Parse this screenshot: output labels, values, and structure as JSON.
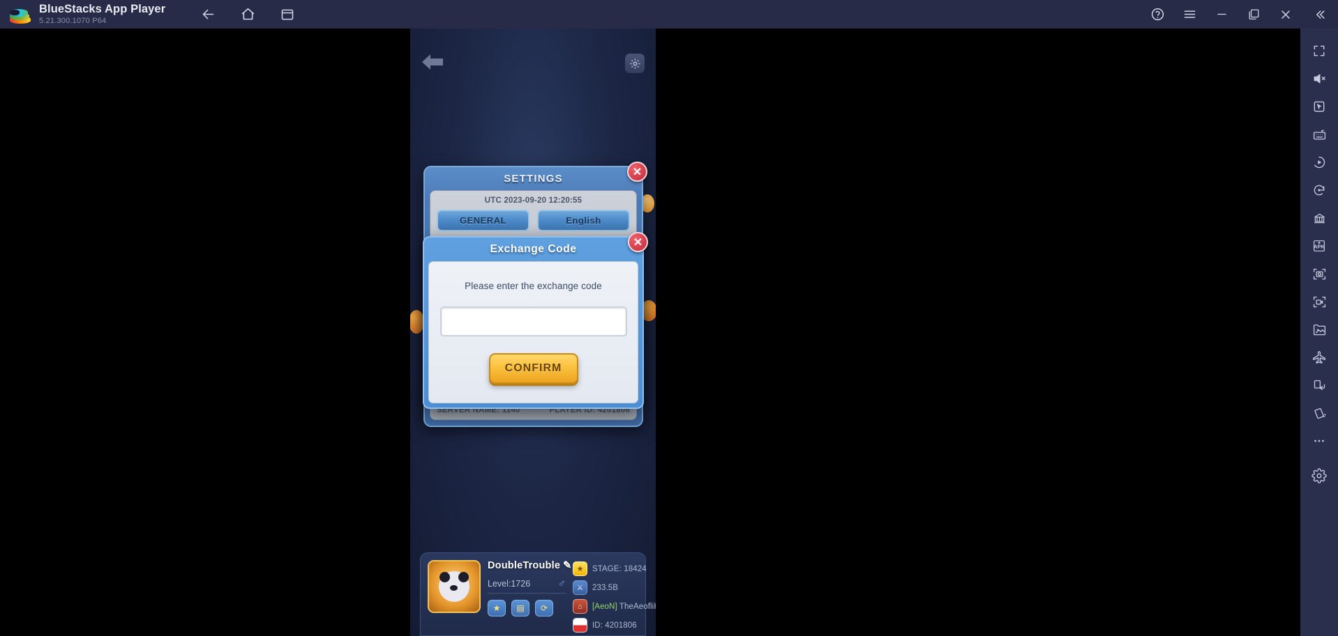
{
  "titlebar": {
    "app_title": "BlueStacks App Player",
    "version": "5.21.300.1070  P64",
    "nav": [
      {
        "name": "back",
        "glyph": "←"
      },
      {
        "name": "home",
        "glyph": "⌂"
      },
      {
        "name": "recents",
        "glyph": "▭"
      }
    ],
    "right": [
      {
        "name": "help",
        "glyph": "?"
      },
      {
        "name": "menu",
        "glyph": "☰"
      },
      {
        "name": "minimize",
        "glyph": "—"
      },
      {
        "name": "maximize",
        "glyph": "❐"
      },
      {
        "name": "close",
        "glyph": "✕"
      },
      {
        "name": "collapse",
        "glyph": "«"
      }
    ]
  },
  "sidebar": {
    "items": [
      {
        "name": "fullscreen-icon",
        "label": "Fullscreen"
      },
      {
        "name": "mute-icon",
        "label": "Mute"
      },
      {
        "name": "cursor-icon",
        "label": "Cursor"
      },
      {
        "name": "keyboard-controls-icon",
        "label": "Game controls"
      },
      {
        "name": "macro-icon",
        "label": "Macro recorder"
      },
      {
        "name": "rotate-icon",
        "label": "Rotate"
      },
      {
        "name": "multi-instance-icon",
        "label": "Multi-instance manager"
      },
      {
        "name": "install-apk-icon",
        "label": "Install APK"
      },
      {
        "name": "screenshot-icon",
        "label": "Screenshot"
      },
      {
        "name": "record-screen-icon",
        "label": "Record screen"
      },
      {
        "name": "media-manager-icon",
        "label": "Media manager"
      },
      {
        "name": "eco-mode-icon",
        "label": "Eco mode"
      },
      {
        "name": "rotate-screen-icon",
        "label": "Rotate screen"
      },
      {
        "name": "shake-icon",
        "label": "Shake"
      },
      {
        "name": "more-icon",
        "label": "More"
      },
      {
        "name": "settings-gear-icon",
        "label": "Settings"
      }
    ]
  },
  "game": {
    "back_label": "Back",
    "gear_label": "Settings",
    "settings": {
      "title": "SETTINGS",
      "close_label": "✕",
      "utc_time": "UTC 2023-09-20 12:20:55",
      "options": [
        "GENERAL",
        "English",
        "",
        "",
        "",
        ""
      ],
      "server_name": "SERVER NAME: 1140",
      "player_id": "PLAYER ID: 4201806"
    },
    "exchange": {
      "title": "Exchange Code",
      "close_label": "✕",
      "prompt": "Please enter the exchange code",
      "input_value": "",
      "input_placeholder": "",
      "confirm_label": "CONFIRM"
    },
    "player": {
      "name": "DoubleTrouble",
      "edit_icon": "✎",
      "level": "Level:1726",
      "gender": "♂",
      "actions": [
        {
          "name": "badge-button",
          "glyph": "★"
        },
        {
          "name": "records-button",
          "glyph": "▤"
        },
        {
          "name": "refresh-button",
          "glyph": "⟳"
        }
      ],
      "stats": [
        {
          "icon": "star-icon",
          "text": "STAGE: 18424"
        },
        {
          "icon": "sword-icon",
          "text": "233.5B"
        },
        {
          "icon": "guild-icon",
          "tag": "[AeoN]",
          "text": "TheAeofliKings"
        },
        {
          "icon": "flag-icon",
          "text": "ID: 4201806"
        }
      ]
    }
  },
  "colors": {
    "titlebar_bg": "#272b47",
    "sidebar_bg": "#2b2f4e",
    "accent_blue": "#4c8ed4",
    "confirm_yellow": "#fbc13f",
    "close_red": "#c1293a"
  }
}
